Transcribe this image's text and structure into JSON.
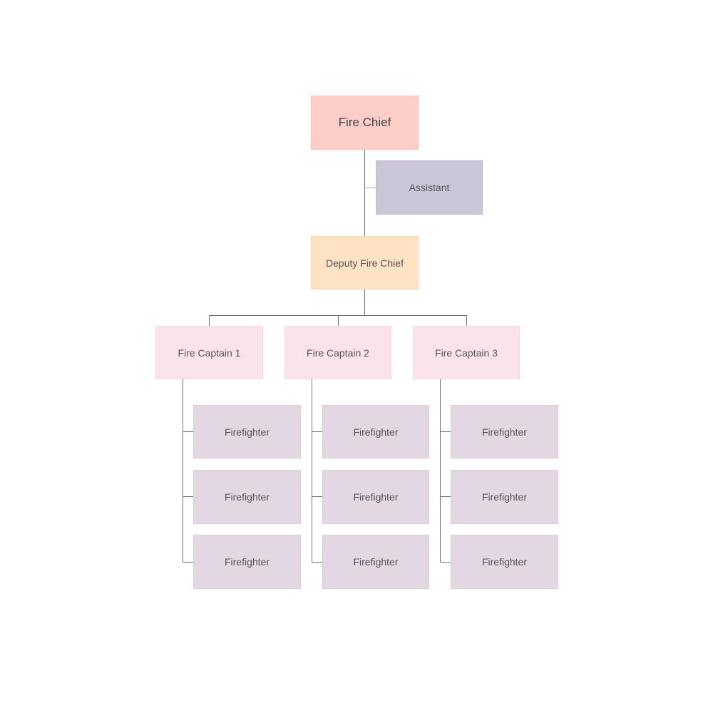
{
  "chart": {
    "fire_chief": "Fire Chief",
    "assistant": "Assistant",
    "deputy": "Deputy Fire Chief",
    "captains": [
      {
        "label": "Fire Captain 1",
        "members": [
          "Firefighter",
          "Firefighter",
          "Firefighter"
        ]
      },
      {
        "label": "Fire Captain 2",
        "members": [
          "Firefighter",
          "Firefighter",
          "Firefighter"
        ]
      },
      {
        "label": "Fire Captain 3",
        "members": [
          "Firefighter",
          "Firefighter",
          "Firefighter"
        ]
      }
    ]
  },
  "colors": {
    "fire_chief": "#fdcdc8",
    "assistant": "#cac6d8",
    "deputy": "#fde2c4",
    "captain": "#fbe3ea",
    "firefighter": "#e3d7e3",
    "connector": "#666666"
  }
}
